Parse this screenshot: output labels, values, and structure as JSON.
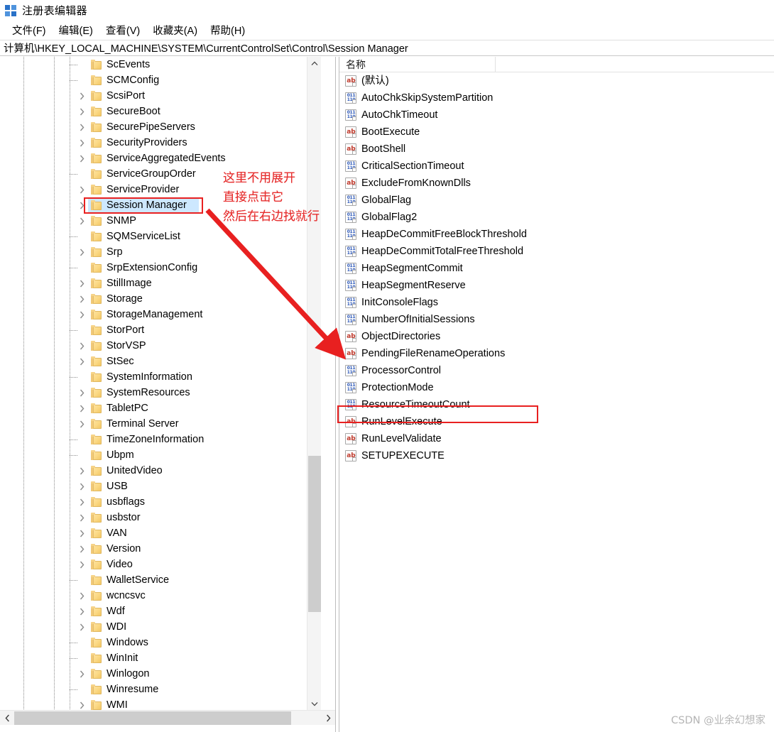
{
  "window": {
    "title": "注册表编辑器",
    "icon": "registry-editor-icon"
  },
  "menubar": {
    "items": [
      {
        "label": "文件(F)",
        "name": "menu-file"
      },
      {
        "label": "编辑(E)",
        "name": "menu-edit"
      },
      {
        "label": "查看(V)",
        "name": "menu-view"
      },
      {
        "label": "收藏夹(A)",
        "name": "menu-favorites"
      },
      {
        "label": "帮助(H)",
        "name": "menu-help"
      }
    ]
  },
  "address": {
    "path": "计算机\\HKEY_LOCAL_MACHINE\\SYSTEM\\CurrentControlSet\\Control\\Session Manager"
  },
  "tree": {
    "items": [
      {
        "label": "ScEvents",
        "expandable": false,
        "selected": false
      },
      {
        "label": "SCMConfig",
        "expandable": false,
        "selected": false
      },
      {
        "label": "ScsiPort",
        "expandable": true,
        "selected": false
      },
      {
        "label": "SecureBoot",
        "expandable": true,
        "selected": false
      },
      {
        "label": "SecurePipeServers",
        "expandable": true,
        "selected": false
      },
      {
        "label": "SecurityProviders",
        "expandable": true,
        "selected": false
      },
      {
        "label": "ServiceAggregatedEvents",
        "expandable": true,
        "selected": false
      },
      {
        "label": "ServiceGroupOrder",
        "expandable": false,
        "selected": false
      },
      {
        "label": "ServiceProvider",
        "expandable": true,
        "selected": false
      },
      {
        "label": "Session Manager",
        "expandable": true,
        "selected": true
      },
      {
        "label": "SNMP",
        "expandable": true,
        "selected": false
      },
      {
        "label": "SQMServiceList",
        "expandable": false,
        "selected": false
      },
      {
        "label": "Srp",
        "expandable": true,
        "selected": false
      },
      {
        "label": "SrpExtensionConfig",
        "expandable": false,
        "selected": false
      },
      {
        "label": "StillImage",
        "expandable": true,
        "selected": false
      },
      {
        "label": "Storage",
        "expandable": true,
        "selected": false
      },
      {
        "label": "StorageManagement",
        "expandable": true,
        "selected": false
      },
      {
        "label": "StorPort",
        "expandable": false,
        "selected": false
      },
      {
        "label": "StorVSP",
        "expandable": true,
        "selected": false
      },
      {
        "label": "StSec",
        "expandable": true,
        "selected": false
      },
      {
        "label": "SystemInformation",
        "expandable": false,
        "selected": false
      },
      {
        "label": "SystemResources",
        "expandable": true,
        "selected": false
      },
      {
        "label": "TabletPC",
        "expandable": true,
        "selected": false
      },
      {
        "label": "Terminal Server",
        "expandable": true,
        "selected": false
      },
      {
        "label": "TimeZoneInformation",
        "expandable": false,
        "selected": false
      },
      {
        "label": "Ubpm",
        "expandable": false,
        "selected": false
      },
      {
        "label": "UnitedVideo",
        "expandable": true,
        "selected": false
      },
      {
        "label": "USB",
        "expandable": true,
        "selected": false
      },
      {
        "label": "usbflags",
        "expandable": true,
        "selected": false
      },
      {
        "label": "usbstor",
        "expandable": true,
        "selected": false
      },
      {
        "label": "VAN",
        "expandable": true,
        "selected": false
      },
      {
        "label": "Version",
        "expandable": true,
        "selected": false
      },
      {
        "label": "Video",
        "expandable": true,
        "selected": false
      },
      {
        "label": "WalletService",
        "expandable": false,
        "selected": false
      },
      {
        "label": "wcncsvc",
        "expandable": true,
        "selected": false
      },
      {
        "label": "Wdf",
        "expandable": true,
        "selected": false
      },
      {
        "label": "WDI",
        "expandable": true,
        "selected": false
      },
      {
        "label": "Windows",
        "expandable": false,
        "selected": false
      },
      {
        "label": "WinInit",
        "expandable": false,
        "selected": false
      },
      {
        "label": "Winlogon",
        "expandable": true,
        "selected": false
      },
      {
        "label": "Winresume",
        "expandable": false,
        "selected": false
      },
      {
        "label": "WMI",
        "expandable": true,
        "selected": false
      }
    ]
  },
  "list": {
    "columns": [
      {
        "label": "名称",
        "name": "column-name"
      }
    ],
    "rows": [
      {
        "name": "(默认)",
        "type": "string"
      },
      {
        "name": "AutoChkSkipSystemPartition",
        "type": "dword"
      },
      {
        "name": "AutoChkTimeout",
        "type": "dword"
      },
      {
        "name": "BootExecute",
        "type": "string"
      },
      {
        "name": "BootShell",
        "type": "string"
      },
      {
        "name": "CriticalSectionTimeout",
        "type": "dword"
      },
      {
        "name": "ExcludeFromKnownDlls",
        "type": "string"
      },
      {
        "name": "GlobalFlag",
        "type": "dword"
      },
      {
        "name": "GlobalFlag2",
        "type": "dword"
      },
      {
        "name": "HeapDeCommitFreeBlockThreshold",
        "type": "dword"
      },
      {
        "name": "HeapDeCommitTotalFreeThreshold",
        "type": "dword"
      },
      {
        "name": "HeapSegmentCommit",
        "type": "dword"
      },
      {
        "name": "HeapSegmentReserve",
        "type": "dword"
      },
      {
        "name": "InitConsoleFlags",
        "type": "dword"
      },
      {
        "name": "NumberOfInitialSessions",
        "type": "dword"
      },
      {
        "name": "ObjectDirectories",
        "type": "string"
      },
      {
        "name": "PendingFileRenameOperations",
        "type": "string",
        "highlighted": true
      },
      {
        "name": "ProcessorControl",
        "type": "dword"
      },
      {
        "name": "ProtectionMode",
        "type": "dword"
      },
      {
        "name": "ResourceTimeoutCount",
        "type": "dword"
      },
      {
        "name": "RunLevelExecute",
        "type": "string"
      },
      {
        "name": "RunLevelValidate",
        "type": "string"
      },
      {
        "name": "SETUPEXECUTE",
        "type": "string"
      }
    ]
  },
  "annotation": {
    "line1": "这里不用展开",
    "line2": "直接点击它",
    "line3": "然后在右边找就行",
    "color": "#e63030"
  },
  "highlight": {
    "color": "#e82020",
    "selection_color": "#cde8ff"
  },
  "watermark": {
    "text": "CSDN @业余幻想家"
  }
}
